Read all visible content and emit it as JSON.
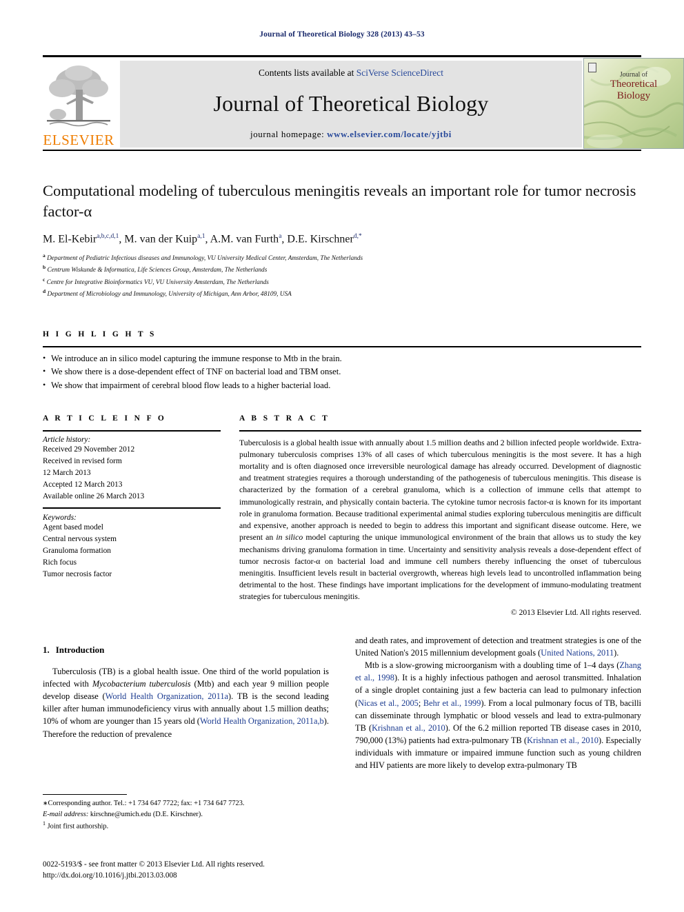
{
  "running_head": "Journal of Theoretical Biology 328 (2013) 43–53",
  "masthead": {
    "contents_prefix": "Contents lists available at ",
    "contents_link": "SciVerse ScienceDirect",
    "journal_title": "Journal of Theoretical Biology",
    "homepage_label": "journal homepage:",
    "homepage_url": "www.elsevier.com/locate/yjtbi",
    "publisher": "ELSEVIER",
    "cover": {
      "line1": "Journal of",
      "line2": "Theoretical",
      "line3": "Biology"
    }
  },
  "article": {
    "title": "Computational modeling of tuberculous meningitis reveals an important role for tumor necrosis factor-α",
    "authors_html": "M. El-Kebir",
    "authors": [
      {
        "name": "M. El-Kebir",
        "sup": "a,b,c,d,1"
      },
      {
        "name": "M. van der Kuip",
        "sup": "a,1"
      },
      {
        "name": "A.M. van Furth",
        "sup": "a"
      },
      {
        "name": "D.E. Kirschner",
        "sup": "d,*"
      }
    ],
    "affiliations": [
      {
        "key": "a",
        "text": "Department of Pediatric Infectious diseases and Immunology, VU University Medical Center, Amsterdam, The Netherlands"
      },
      {
        "key": "b",
        "text": "Centrum Wiskunde & Informatica, Life Sciences Group, Amsterdam, The Netherlands"
      },
      {
        "key": "c",
        "text": "Centre for Integrative Bioinformatics VU, VU University Amsterdam, The Netherlands"
      },
      {
        "key": "d",
        "text": "Department of Microbiology and Immunology, University of Michigan, Ann Arbor, 48109, USA"
      }
    ]
  },
  "highlights": {
    "label": "H I G H L I G H T S",
    "items": [
      "We introduce an in silico model capturing the immune response to Mtb in the brain.",
      "We show there is a dose-dependent effect of TNF on bacterial load and TBM onset.",
      "We show that impairment of cerebral blood flow leads to a higher bacterial load."
    ]
  },
  "article_info": {
    "label": "A R T I C L E   I N F O",
    "history_title": "Article history:",
    "history": [
      "Received 29 November 2012",
      "Received in revised form",
      "12 March 2013",
      "Accepted 12 March 2013",
      "Available online 26 March 2013"
    ],
    "keywords_title": "Keywords:",
    "keywords": [
      "Agent based model",
      "Central nervous system",
      "Granuloma formation",
      "Rich focus",
      "Tumor necrosis factor"
    ]
  },
  "abstract": {
    "label": "A B S T R A C T",
    "text_part1": "Tuberculosis is a global health issue with annually about 1.5 million deaths and 2 billion infected people worldwide. Extra-pulmonary tuberculosis comprises 13% of all cases of which tuberculous meningitis is the most severe. It has a high mortality and is often diagnosed once irreversible neurological damage has already occurred. Development of diagnostic and treatment strategies requires a thorough understanding of the pathogenesis of tuberculous meningitis. This disease is characterized by the formation of a cerebral granuloma, which is a collection of immune cells that attempt to immunologically restrain, and physically contain bacteria. The cytokine tumor necrosis factor-α is known for its important role in granuloma formation. Because traditional experimental animal studies exploring tuberculous meningitis are difficult and expensive, another approach is needed to begin to address this important and significant disease outcome. Here, we present an ",
    "italic1": "in silico",
    "text_part2": " model capturing the unique immunological environment of the brain that allows us to study the key mechanisms driving granuloma formation in time. Uncertainty and sensitivity analysis reveals a dose-dependent effect of tumor necrosis factor-α on bacterial load and immune cell numbers thereby influencing the onset of tuberculous meningitis. Insufficient levels result in bacterial overgrowth, whereas high levels lead to uncontrolled inflammation being detrimental to the host. These findings have important implications for the development of immuno-modulating treatment strategies for tuberculous meningitis.",
    "copyright": "© 2013 Elsevier Ltd. All rights reserved."
  },
  "body": {
    "section_number": "1.",
    "section_title": "Introduction",
    "left_paragraph_1": {
      "p1": "Tuberculosis (TB) is a global health issue. One third of the world population is infected with ",
      "ital1": "Mycobacterium tuberculosis",
      "p2": " (Mtb) and each year 9 million people develop disease (",
      "cite1": "World Health Organization, 2011a",
      "p3": "). TB is the second leading killer after human immunodeficiency virus with annually about 1.5 million deaths; 10% of whom are younger than 15 years old (",
      "cite2": "World Health Organization, 2011a,b",
      "p4": "). Therefore the reduction of prevalence"
    },
    "right_paragraph_1": {
      "p1": "and death rates, and improvement of detection and treatment strategies is one of the United Nation's 2015 millennium development goals (",
      "cite1": "United Nations, 2011",
      "p2": ")."
    },
    "right_paragraph_2": {
      "p1": "Mtb is a slow-growing microorganism with a doubling time of 1–4 days (",
      "cite1": "Zhang et al., 1998",
      "p2": "). It is a highly infectious pathogen and aerosol transmitted. Inhalation of a single droplet containing just a few bacteria can lead to pulmonary infection (",
      "cite2": "Nicas et al., 2005",
      "p3": "; ",
      "cite3": "Behr et al., 1999",
      "p4": "). From a local pulmonary focus of TB, bacilli can disseminate through lymphatic or blood vessels and lead to extra-pulmonary TB (",
      "cite4": "Krishnan et al., 2010",
      "p5": "). Of the 6.2 million reported TB disease cases in 2010, 790,000 (13%) patients had extra-pulmonary TB (",
      "cite5": "Krishnan et al., 2010",
      "p6": "). Especially individuals with immature or impaired immune function such as young children and HIV patients are more likely to develop extra-pulmonary TB"
    }
  },
  "footnotes": {
    "corresponding": "Corresponding author. Tel.: +1 734 647 7722; fax: +1 734 647 7723.",
    "email_label": "E-mail address:",
    "email_value": " kirschne@umich.edu (D.E. Kirschner).",
    "joint": "Joint first authorship."
  },
  "issn": {
    "line1": "0022-5193/$ - see front matter © 2013 Elsevier Ltd. All rights reserved.",
    "line2": "http://dx.doi.org/10.1016/j.jtbi.2013.03.008"
  },
  "colors": {
    "link_blue": "#2a4b9b",
    "cite_blue": "#1a3a8f",
    "running_head_blue": "#1a2a6c",
    "elsevier_orange": "#ef7d00",
    "cover_red": "#7d1d1d",
    "band_grey": "#e3e3e3"
  }
}
